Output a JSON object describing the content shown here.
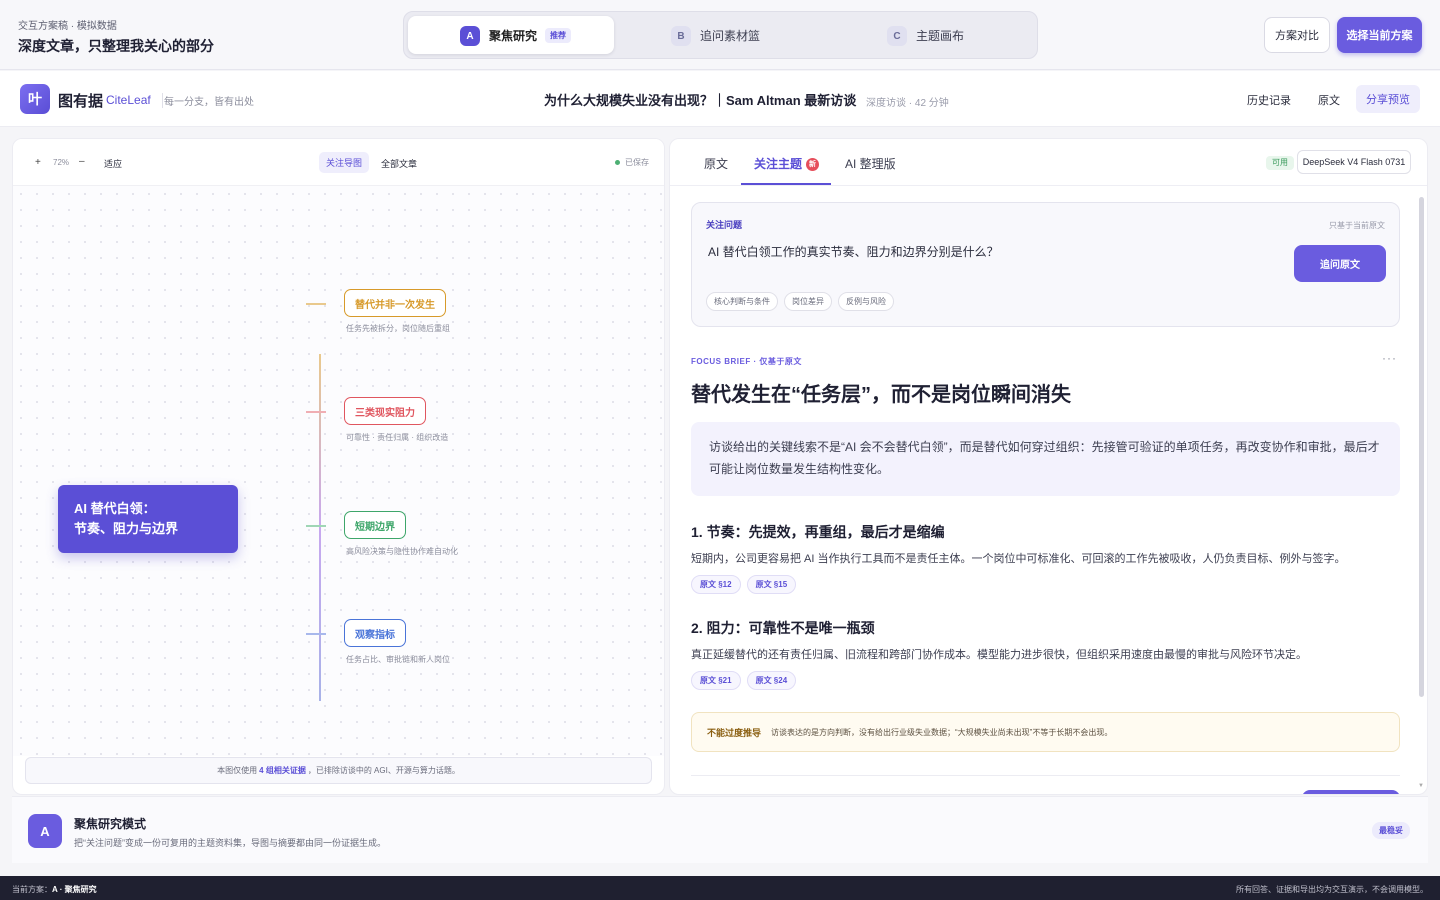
{
  "prototype": {
    "subtitle": "交互方案稿 · 模拟数据",
    "title": "深度文章，只整理我关心的部分",
    "segments": [
      {
        "badge": "A",
        "label": "聚焦研究",
        "tag": "推荐"
      },
      {
        "badge": "B",
        "label": "追问素材篮",
        "tag": ""
      },
      {
        "badge": "C",
        "label": "主题画布",
        "tag": ""
      }
    ],
    "compare_label": "方案对比",
    "choose_label": "选择当前方案"
  },
  "app": {
    "logo_char": "叶",
    "brand": "图有据",
    "brand_en": "CiteLeaf",
    "slogan": "每一分支，皆有出处",
    "doc_title": "为什么大规模失业没有出现？｜Sam Altman 最新访谈",
    "doc_meta": "深度访谈 · 42 分钟",
    "nav_history": "历史记录",
    "nav_original": "原文",
    "nav_share": "分享预览"
  },
  "mindmap": {
    "zoom_in": "+",
    "zoom_level": "72%",
    "zoom_out": "–",
    "fit": "适应",
    "view_focus": "关注导图",
    "view_all": "全部文章",
    "saved": "已保存",
    "root_line1": "AI 替代白领：",
    "root_line2": "节奏、阻力与边界",
    "nodes": [
      {
        "label": "替代并非一次发生",
        "sub": "任务先被拆分，岗位随后重组",
        "color": "#d79a2a"
      },
      {
        "label": "三类现实阻力",
        "sub": "可靠性 · 责任归属 · 组织改造",
        "color": "#e0565f"
      },
      {
        "label": "短期边界",
        "sub": "高风险决策与隐性协作难自动化",
        "color": "#3ea66a"
      },
      {
        "label": "观察指标",
        "sub": "任务占比、审批链和新人岗位",
        "color": "#4a74d8"
      }
    ],
    "note_prefix": "本图仅使用",
    "note_count": "4 组相关证据",
    "note_suffix": "，已排除访谈中的 AGI、开源与算力话题。"
  },
  "reader": {
    "tabs": {
      "original": "原文",
      "focus": "关注主题",
      "focus_badge": "新",
      "ai": "AI 整理版"
    },
    "avail": "可用",
    "model": "DeepSeek V4 Flash 0731",
    "question_label": "关注问题",
    "question_hint": "只基于当前原文",
    "question_text": "AI 替代白领工作的真实节奏、阻力和边界分别是什么？",
    "ask_button": "追问原文",
    "chips": [
      "核心判断与条件",
      "岗位差异",
      "反例与风险"
    ],
    "kicker": "FOCUS BRIEF · 仅基于原文",
    "more": "···",
    "headline": "替代发生在“任务层”，而不是岗位瞬间消失",
    "summary": "访谈给出的关键线索不是“AI 会不会替代白领”，而是替代如何穿过组织：先接管可验证的单项任务，再改变协作和审批，最后才可能让岗位数量发生结构性变化。",
    "sections": [
      {
        "title": "1. 节奏：先提效，再重组，最后才是缩编",
        "body": "短期内，公司更容易把 AI 当作执行工具而不是责任主体。一个岗位中可标准化、可回滚的工作先被吸收，人仍负责目标、例外与签字。",
        "cites": [
          "原文 §12",
          "原文 §15"
        ]
      },
      {
        "title": "2. 阻力：可靠性不是唯一瓶颈",
        "body": "真正延缓替代的还有责任归属、旧流程和跨部门协作成本。模型能力进步很快，但组织采用速度由最慢的审批与风险环节决定。",
        "cites": [
          "原文 §21",
          "原文 §24"
        ]
      }
    ],
    "warn_label": "不能过度推导",
    "warn_text": "访谈表达的是方向判断，没有给出行业级失业数据；“大规模失业尚未出现”不等于长期不会出现。"
  },
  "mode": {
    "badge": "A",
    "title": "聚焦研究模式",
    "desc": "把“关注问题”变成一份可复用的主题资料集，导图与摘要都由同一份证据生成。",
    "tag": "最稳妥"
  },
  "footer": {
    "left_prefix": "当前方案：",
    "left_value": "A · 聚焦研究",
    "right": "所有回答、证据和导出均为交互演示，不会调用模型。"
  }
}
